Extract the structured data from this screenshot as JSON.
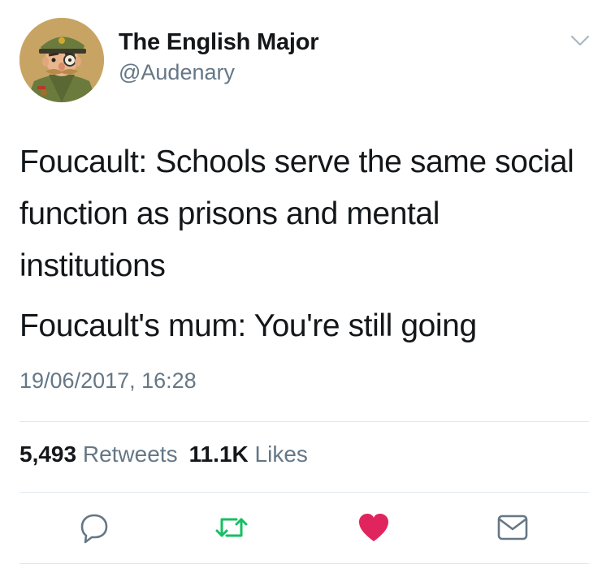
{
  "author": {
    "display_name": "The English Major",
    "handle": "@Audenary"
  },
  "tweet": {
    "paragraphs": [
      "Foucault: Schools serve the same social function as prisons and mental institutions",
      "Foucault's mum: You're still going"
    ],
    "timestamp": "19/06/2017, 16:28"
  },
  "stats": {
    "retweets_count": "5,493",
    "retweets_label": "Retweets",
    "likes_count": "11.1K",
    "likes_label": "Likes"
  },
  "icons": {
    "menu": "chevron-down-icon",
    "reply": "reply-icon",
    "retweet": "retweet-icon",
    "like": "heart-icon",
    "share": "envelope-icon"
  },
  "colors": {
    "text_primary": "#14171a",
    "text_secondary": "#657786",
    "retweet_green": "#17bf63",
    "like_red": "#e0245e",
    "icon_gray": "#657786",
    "divider": "#e1e8ed"
  }
}
